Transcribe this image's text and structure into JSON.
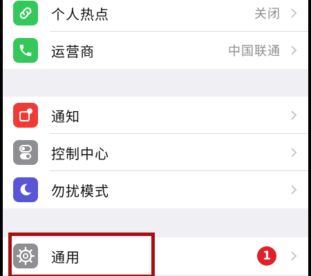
{
  "settings": {
    "groups": [
      [
        {
          "label": "个人热点",
          "value": "关闭",
          "icon": "hotspot-icon",
          "color": "#34c759"
        },
        {
          "label": "运营商",
          "value": "中国联通",
          "icon": "phone-icon",
          "color": "#34c759"
        }
      ],
      [
        {
          "label": "通知",
          "icon": "notifications-icon",
          "color": "#ef3a36"
        },
        {
          "label": "控制中心",
          "icon": "control-center-icon",
          "color": "#8e8e93"
        },
        {
          "label": "勿扰模式",
          "icon": "moon-icon",
          "color": "#5856d6"
        }
      ],
      [
        {
          "label": "通用",
          "badge": "1",
          "icon": "gear-icon",
          "color": "#8e8e93"
        }
      ]
    ]
  },
  "highlight_color": "#a80d12"
}
